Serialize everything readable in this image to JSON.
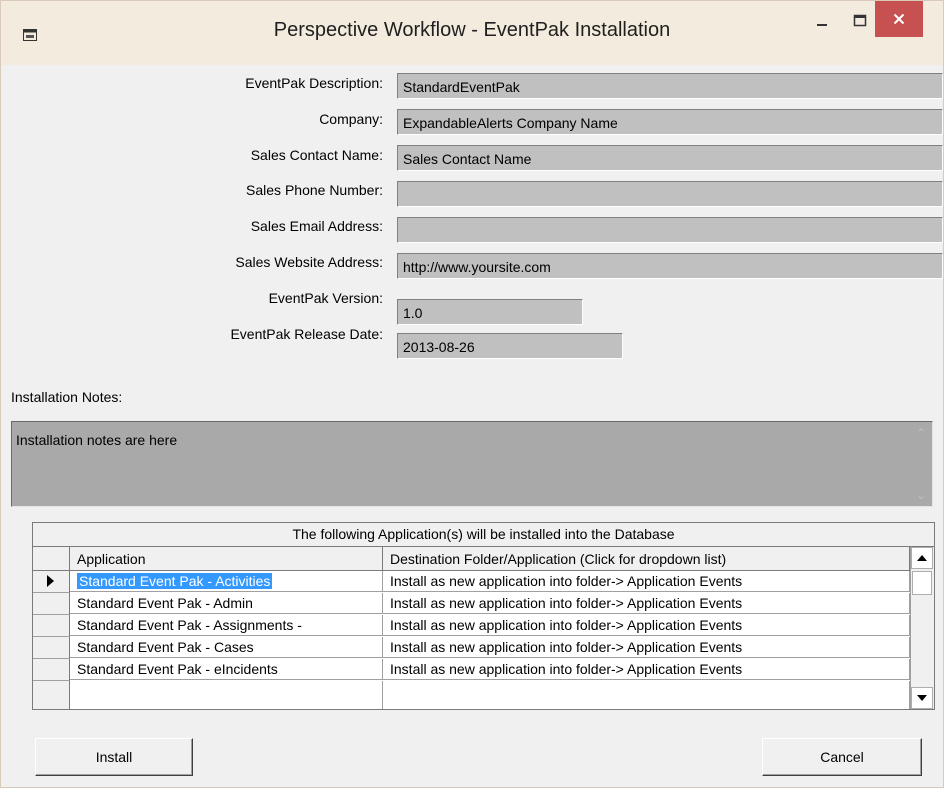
{
  "window": {
    "title": "Perspective Workflow - EventPak Installation",
    "icon": "application-icon",
    "controls": {
      "minimize": "minimize-icon",
      "maximize": "maximize-icon",
      "close": "close-icon"
    },
    "accent": "#c75050"
  },
  "form": {
    "fields": [
      {
        "label": "EventPak Description:",
        "value": "StandardEventPak"
      },
      {
        "label": "Company:",
        "value": "ExpandableAlerts Company Name"
      },
      {
        "label": "Sales Contact Name:",
        "value": "Sales Contact Name"
      },
      {
        "label": "Sales Phone Number:",
        "value": ""
      },
      {
        "label": "Sales Email Address:",
        "value": ""
      },
      {
        "label": "Sales Website Address:",
        "value": "http://www.yoursite.com"
      },
      {
        "label": "EventPak Version:",
        "value": "1.0"
      },
      {
        "label": "EventPak Release Date:",
        "value": "2013-08-26"
      }
    ]
  },
  "notes": {
    "label": "Installation Notes:",
    "text": "Installation notes are here"
  },
  "grid": {
    "caption": "The following Application(s) will be installed into the Database",
    "columns": [
      "Application",
      "Destination Folder/Application (Click for dropdown list)"
    ],
    "rows": [
      {
        "application": "Standard Event Pak - Activities",
        "destination": "Install as new application into folder-> Application Events",
        "selected": true
      },
      {
        "application": "Standard Event Pak - Admin",
        "destination": "Install as new application into folder-> Application Events",
        "selected": false
      },
      {
        "application": "Standard Event Pak - Assignments -",
        "destination": "Install as new application into folder-> Application Events",
        "selected": false
      },
      {
        "application": "Standard Event Pak - Cases",
        "destination": "Install as new application into folder-> Application Events",
        "selected": false
      },
      {
        "application": "Standard Event Pak - eIncidents",
        "destination": "Install as new application into folder-> Application Events",
        "selected": false
      }
    ]
  },
  "buttons": {
    "install": "Install",
    "cancel": "Cancel"
  }
}
